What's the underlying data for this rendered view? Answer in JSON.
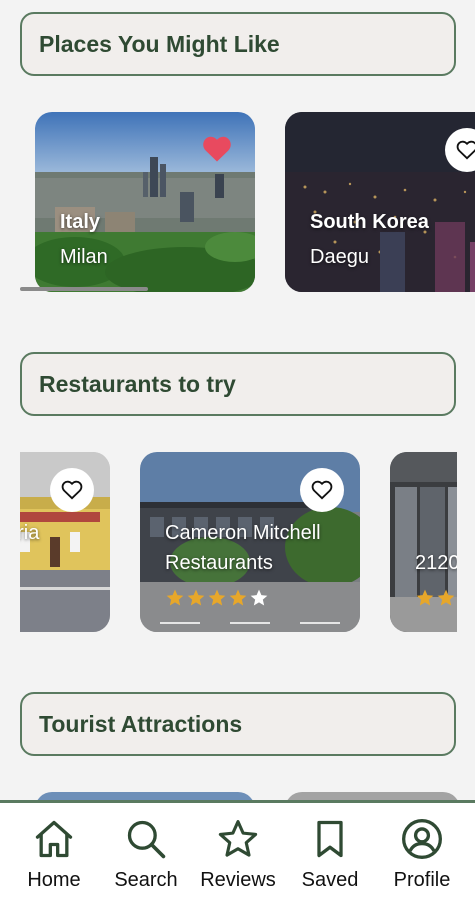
{
  "sections": {
    "places_title": "Places You Might Like",
    "restaurants_title": "Restaurants to try",
    "attractions_title": "Tourist Attractions"
  },
  "places": [
    {
      "country": "Italy",
      "city": "Milan",
      "favorited": true
    },
    {
      "country": "South Korea",
      "city": "Daegu",
      "favorited": false
    }
  ],
  "restaurants": [
    {
      "name_partial": "oria",
      "favorited": false
    },
    {
      "name": "Cameron Mitchell Restaurants",
      "name_line1": "Cameron Mitchell",
      "name_line2": "Restaurants",
      "rating": 4,
      "favorited": false
    },
    {
      "name_partial": "2120",
      "rating_visible_partial": true,
      "favorited": false
    }
  ],
  "tabs": [
    {
      "label": "Home",
      "icon": "home-icon"
    },
    {
      "label": "Search",
      "icon": "search-icon"
    },
    {
      "label": "Reviews",
      "icon": "star-icon"
    },
    {
      "label": "Saved",
      "icon": "bookmark-icon"
    },
    {
      "label": "Profile",
      "icon": "profile-icon"
    }
  ],
  "colors": {
    "accent": "#5a7a60",
    "heading_text": "#2f4a33",
    "heart_favorited": "#e84a5f",
    "star_filled": "#e7a72a"
  }
}
